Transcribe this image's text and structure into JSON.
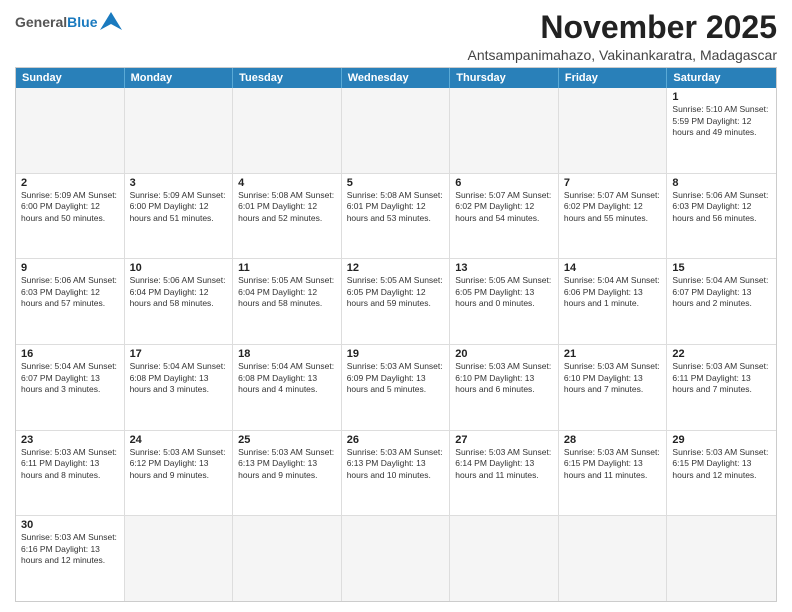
{
  "header": {
    "logo": {
      "general": "General",
      "blue": "Blue"
    },
    "title": "November 2025",
    "location": "Antsampanimahazo, Vakinankaratra, Madagascar"
  },
  "dayHeaders": [
    "Sunday",
    "Monday",
    "Tuesday",
    "Wednesday",
    "Thursday",
    "Friday",
    "Saturday"
  ],
  "weeks": [
    [
      {
        "day": "",
        "empty": true,
        "info": ""
      },
      {
        "day": "",
        "empty": true,
        "info": ""
      },
      {
        "day": "",
        "empty": true,
        "info": ""
      },
      {
        "day": "",
        "empty": true,
        "info": ""
      },
      {
        "day": "",
        "empty": true,
        "info": ""
      },
      {
        "day": "",
        "empty": true,
        "info": ""
      },
      {
        "day": "1",
        "empty": false,
        "info": "Sunrise: 5:10 AM\nSunset: 5:59 PM\nDaylight: 12 hours\nand 49 minutes."
      }
    ],
    [
      {
        "day": "2",
        "empty": false,
        "info": "Sunrise: 5:09 AM\nSunset: 6:00 PM\nDaylight: 12 hours\nand 50 minutes."
      },
      {
        "day": "3",
        "empty": false,
        "info": "Sunrise: 5:09 AM\nSunset: 6:00 PM\nDaylight: 12 hours\nand 51 minutes."
      },
      {
        "day": "4",
        "empty": false,
        "info": "Sunrise: 5:08 AM\nSunset: 6:01 PM\nDaylight: 12 hours\nand 52 minutes."
      },
      {
        "day": "5",
        "empty": false,
        "info": "Sunrise: 5:08 AM\nSunset: 6:01 PM\nDaylight: 12 hours\nand 53 minutes."
      },
      {
        "day": "6",
        "empty": false,
        "info": "Sunrise: 5:07 AM\nSunset: 6:02 PM\nDaylight: 12 hours\nand 54 minutes."
      },
      {
        "day": "7",
        "empty": false,
        "info": "Sunrise: 5:07 AM\nSunset: 6:02 PM\nDaylight: 12 hours\nand 55 minutes."
      },
      {
        "day": "8",
        "empty": false,
        "info": "Sunrise: 5:06 AM\nSunset: 6:03 PM\nDaylight: 12 hours\nand 56 minutes."
      }
    ],
    [
      {
        "day": "9",
        "empty": false,
        "info": "Sunrise: 5:06 AM\nSunset: 6:03 PM\nDaylight: 12 hours\nand 57 minutes."
      },
      {
        "day": "10",
        "empty": false,
        "info": "Sunrise: 5:06 AM\nSunset: 6:04 PM\nDaylight: 12 hours\nand 58 minutes."
      },
      {
        "day": "11",
        "empty": false,
        "info": "Sunrise: 5:05 AM\nSunset: 6:04 PM\nDaylight: 12 hours\nand 58 minutes."
      },
      {
        "day": "12",
        "empty": false,
        "info": "Sunrise: 5:05 AM\nSunset: 6:05 PM\nDaylight: 12 hours\nand 59 minutes."
      },
      {
        "day": "13",
        "empty": false,
        "info": "Sunrise: 5:05 AM\nSunset: 6:05 PM\nDaylight: 13 hours\nand 0 minutes."
      },
      {
        "day": "14",
        "empty": false,
        "info": "Sunrise: 5:04 AM\nSunset: 6:06 PM\nDaylight: 13 hours\nand 1 minute."
      },
      {
        "day": "15",
        "empty": false,
        "info": "Sunrise: 5:04 AM\nSunset: 6:07 PM\nDaylight: 13 hours\nand 2 minutes."
      }
    ],
    [
      {
        "day": "16",
        "empty": false,
        "info": "Sunrise: 5:04 AM\nSunset: 6:07 PM\nDaylight: 13 hours\nand 3 minutes."
      },
      {
        "day": "17",
        "empty": false,
        "info": "Sunrise: 5:04 AM\nSunset: 6:08 PM\nDaylight: 13 hours\nand 3 minutes."
      },
      {
        "day": "18",
        "empty": false,
        "info": "Sunrise: 5:04 AM\nSunset: 6:08 PM\nDaylight: 13 hours\nand 4 minutes."
      },
      {
        "day": "19",
        "empty": false,
        "info": "Sunrise: 5:03 AM\nSunset: 6:09 PM\nDaylight: 13 hours\nand 5 minutes."
      },
      {
        "day": "20",
        "empty": false,
        "info": "Sunrise: 5:03 AM\nSunset: 6:10 PM\nDaylight: 13 hours\nand 6 minutes."
      },
      {
        "day": "21",
        "empty": false,
        "info": "Sunrise: 5:03 AM\nSunset: 6:10 PM\nDaylight: 13 hours\nand 7 minutes."
      },
      {
        "day": "22",
        "empty": false,
        "info": "Sunrise: 5:03 AM\nSunset: 6:11 PM\nDaylight: 13 hours\nand 7 minutes."
      }
    ],
    [
      {
        "day": "23",
        "empty": false,
        "info": "Sunrise: 5:03 AM\nSunset: 6:11 PM\nDaylight: 13 hours\nand 8 minutes."
      },
      {
        "day": "24",
        "empty": false,
        "info": "Sunrise: 5:03 AM\nSunset: 6:12 PM\nDaylight: 13 hours\nand 9 minutes."
      },
      {
        "day": "25",
        "empty": false,
        "info": "Sunrise: 5:03 AM\nSunset: 6:13 PM\nDaylight: 13 hours\nand 9 minutes."
      },
      {
        "day": "26",
        "empty": false,
        "info": "Sunrise: 5:03 AM\nSunset: 6:13 PM\nDaylight: 13 hours\nand 10 minutes."
      },
      {
        "day": "27",
        "empty": false,
        "info": "Sunrise: 5:03 AM\nSunset: 6:14 PM\nDaylight: 13 hours\nand 11 minutes."
      },
      {
        "day": "28",
        "empty": false,
        "info": "Sunrise: 5:03 AM\nSunset: 6:15 PM\nDaylight: 13 hours\nand 11 minutes."
      },
      {
        "day": "29",
        "empty": false,
        "info": "Sunrise: 5:03 AM\nSunset: 6:15 PM\nDaylight: 13 hours\nand 12 minutes."
      }
    ],
    [
      {
        "day": "30",
        "empty": false,
        "info": "Sunrise: 5:03 AM\nSunset: 6:16 PM\nDaylight: 13 hours\nand 12 minutes."
      },
      {
        "day": "",
        "empty": true,
        "info": ""
      },
      {
        "day": "",
        "empty": true,
        "info": ""
      },
      {
        "day": "",
        "empty": true,
        "info": ""
      },
      {
        "day": "",
        "empty": true,
        "info": ""
      },
      {
        "day": "",
        "empty": true,
        "info": ""
      },
      {
        "day": "",
        "empty": true,
        "info": ""
      }
    ]
  ]
}
